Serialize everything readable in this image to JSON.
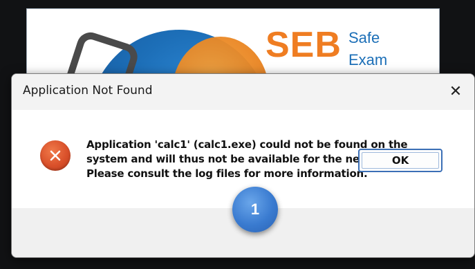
{
  "splash": {
    "logo_text": "SEB",
    "tagline_line1": "Safe",
    "tagline_line2": "Exam"
  },
  "dialog": {
    "title": "Application Not Found",
    "close_glyph": "✕",
    "icon": "error-x-icon",
    "message_lines": [
      "Application 'calc1' (calc1.exe) could not be found on the",
      "system and will thus not be available for the new session!",
      "Please consult the log files for more information."
    ],
    "ok_label": "OK"
  },
  "annotation": {
    "step_number": "1"
  },
  "colors": {
    "seb_orange": "#ef7d22",
    "seb_blue": "#1c6fb7",
    "error_red": "#d9502a",
    "button_border": "#3b6fb6",
    "badge_blue": "#3a7bd0",
    "arrow_yellow": "#f3b316"
  }
}
